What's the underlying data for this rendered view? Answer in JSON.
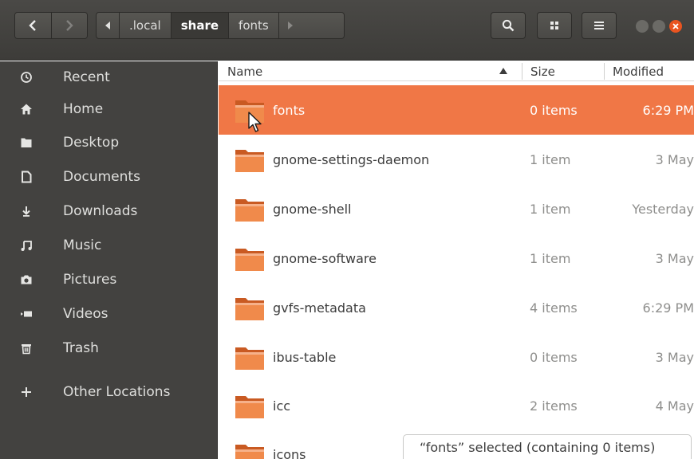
{
  "window": {
    "nav": {
      "back_icon": "chevron-left-icon",
      "forward_icon": "chevron-right-icon"
    },
    "pathbar": {
      "segments": [
        ".local",
        "share",
        "fonts"
      ],
      "current_index": 1
    },
    "controls": {
      "search_icon": "search-icon",
      "view_icon": "grid-view-icon",
      "menu_icon": "hamburger-menu-icon"
    },
    "accent": "#f07746"
  },
  "sidebar": {
    "items": [
      {
        "label": "Recent",
        "icon": "clock-icon"
      },
      {
        "label": "Home",
        "icon": "home-icon"
      },
      {
        "label": "Desktop",
        "icon": "desktop-folder-icon"
      },
      {
        "label": "Documents",
        "icon": "document-icon"
      },
      {
        "label": "Downloads",
        "icon": "download-icon"
      },
      {
        "label": "Music",
        "icon": "music-icon"
      },
      {
        "label": "Pictures",
        "icon": "camera-icon"
      },
      {
        "label": "Videos",
        "icon": "video-icon"
      },
      {
        "label": "Trash",
        "icon": "trash-icon"
      },
      {
        "label": "Other Locations",
        "icon": "plus-icon"
      }
    ]
  },
  "list": {
    "headers": {
      "name": "Name",
      "size": "Size",
      "modified": "Modified"
    },
    "rows": [
      {
        "name": "fonts",
        "size": "0 items",
        "modified": "6:29 PM",
        "selected": true
      },
      {
        "name": "gnome-settings-daemon",
        "size": "1 item",
        "modified": "3 May"
      },
      {
        "name": "gnome-shell",
        "size": "1 item",
        "modified": "Yesterday"
      },
      {
        "name": "gnome-software",
        "size": "1 item",
        "modified": "3 May"
      },
      {
        "name": "gvfs-metadata",
        "size": "4 items",
        "modified": "6:29 PM"
      },
      {
        "name": "ibus-table",
        "size": "0 items",
        "modified": "3 May"
      },
      {
        "name": "icc",
        "size": "2 items",
        "modified": "4 May"
      },
      {
        "name": "icons",
        "size": "",
        "modified": ""
      }
    ]
  },
  "status": {
    "text": "“fonts” selected  (containing 0 items)"
  }
}
